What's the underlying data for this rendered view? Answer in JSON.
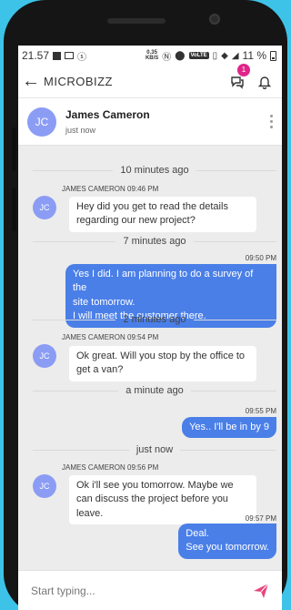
{
  "status_bar": {
    "time": "21.57",
    "speed_top": "0.35",
    "speed_unit": "KB/S",
    "volte": "VoLTE",
    "battery": "11 %"
  },
  "appbar": {
    "back_glyph": "←",
    "title": "MICROBIZZ",
    "notification_count": "1"
  },
  "contact": {
    "initials": "JC",
    "name": "James Cameron",
    "status": "just now"
  },
  "messages": [
    {
      "divider": "10 minutes ago",
      "sender": "JAMES CAMERON 09:46 PM",
      "initials": "JC",
      "text": "Hey did you get to read the details regarding our new project?"
    },
    {
      "divider": "7 minutes ago",
      "time": "09:50 PM",
      "text_lines": [
        "Yes I did. I am planning to do a survey of the",
        "site tomorrow.",
        "I will meet the customer there."
      ]
    },
    {
      "divider": "2 minutes ago",
      "sender": "JAMES CAMERON 09:54 PM",
      "initials": "JC",
      "text": "Ok great. Will you stop by the office to get a van?"
    },
    {
      "divider": "a minute ago",
      "time": "09:55 PM",
      "text": "Yes.. I'll be in by 9"
    },
    {
      "divider": "just now",
      "sender": "JAMES CAMERON 09:56 PM",
      "initials": "JC",
      "text": "Ok i'll see you tomorrow. Maybe we can discuss the project before you leave."
    },
    {
      "time": "09:57 PM",
      "text_lines": [
        "Deal.",
        "See you tomorrow."
      ]
    }
  ],
  "composer": {
    "placeholder": "Start typing..."
  },
  "colors": {
    "background": "#3ec3e8",
    "outgoing_bubble": "#4a7fe8",
    "avatar": "#8b9cf4",
    "badge": "#e0248a",
    "send": "#e8457e"
  }
}
